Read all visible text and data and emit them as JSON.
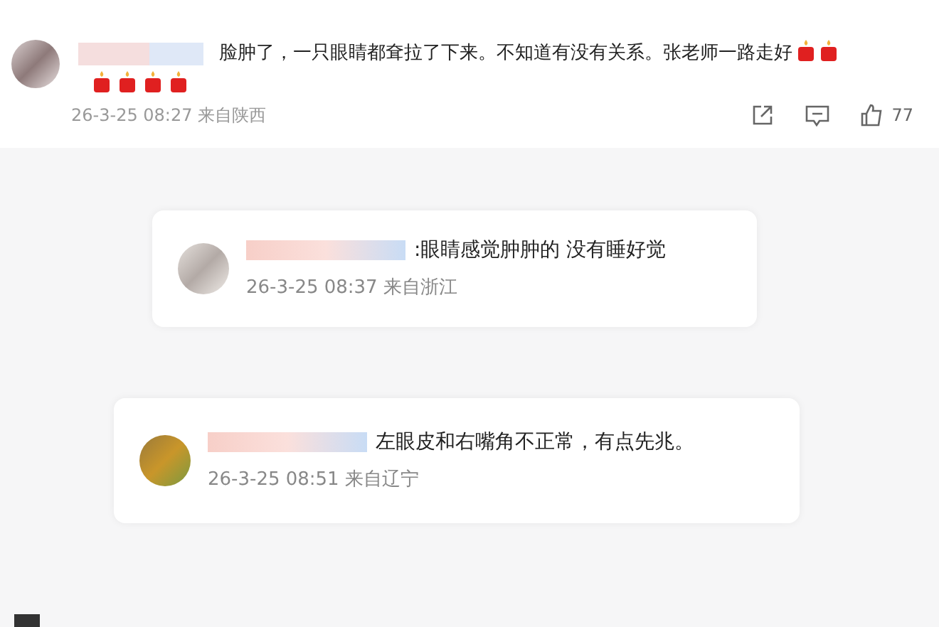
{
  "comment": {
    "text": "脸肿了，一只眼睛都耷拉了下来。不知道有没有关系。张老师一路走好",
    "emojis": [
      {
        "kind": "candle"
      },
      {
        "kind": "candle"
      },
      {
        "kind": "candle"
      },
      {
        "kind": "candle"
      },
      {
        "kind": "candle"
      },
      {
        "kind": "candle"
      }
    ],
    "meta": "26-3-25 08:27 来自陕西",
    "likes": "77"
  },
  "replies": [
    {
      "text": ":眼睛感觉肿肿的 没有睡好觉",
      "meta": "26-3-25 08:37 来自浙江"
    },
    {
      "text": "左眼皮和右嘴角不正常，有点先兆。",
      "meta": "26-3-25 08:51 来自辽宁"
    }
  ]
}
